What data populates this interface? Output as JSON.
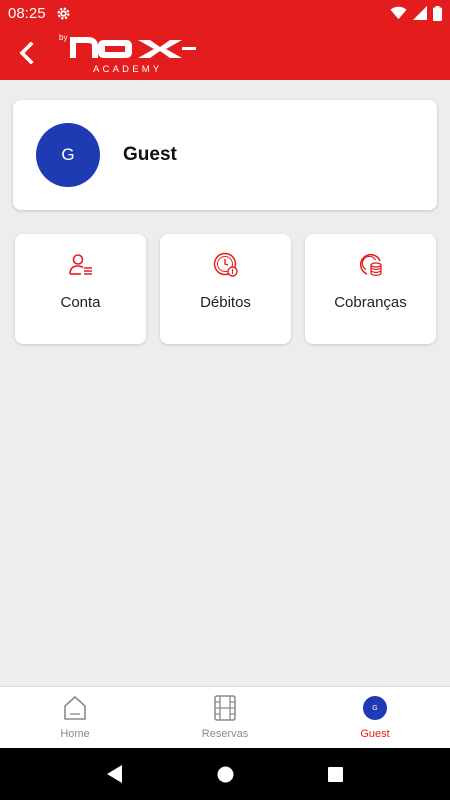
{
  "status_bar": {
    "time": "08:25"
  },
  "header": {
    "logo": {
      "prefix": "by",
      "brand": "NOX",
      "sub": "ACADEMY"
    }
  },
  "profile": {
    "initial": "G",
    "name": "Guest"
  },
  "tiles": [
    {
      "label": "Conta",
      "icon": "user-list-icon"
    },
    {
      "label": "Débitos",
      "icon": "clock-coin-icon"
    },
    {
      "label": "Cobranças",
      "icon": "coins-icon"
    }
  ],
  "bottom_nav": {
    "items": [
      {
        "label": "Home",
        "icon": "home-icon"
      },
      {
        "label": "Reservas",
        "icon": "film-icon"
      },
      {
        "label": "Guest",
        "icon": "avatar",
        "initial": "G",
        "active": true
      }
    ]
  },
  "colors": {
    "brand_red": "#e31d1d",
    "avatar_blue": "#1e3bb3",
    "background": "#ededed"
  }
}
